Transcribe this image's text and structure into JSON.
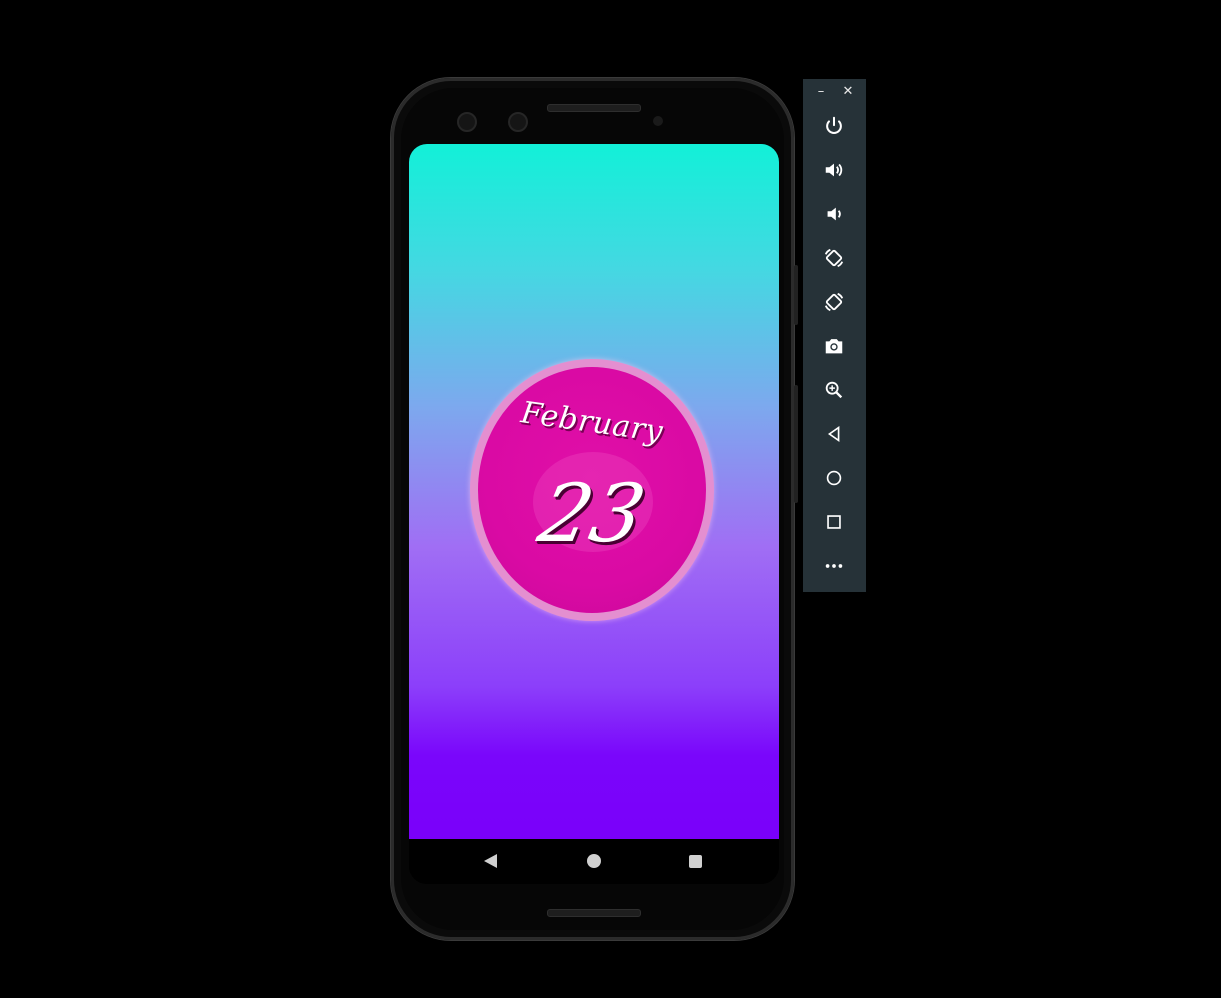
{
  "screen": {
    "month": "February",
    "day": "23"
  },
  "navbar": {
    "back_icon": "back-triangle",
    "home_icon": "home-circle",
    "recents_icon": "recents-square"
  },
  "toolbar": {
    "minimize_label": "–",
    "close_label": "✕",
    "buttons": [
      {
        "name": "power-icon"
      },
      {
        "name": "volume-up-icon"
      },
      {
        "name": "volume-down-icon"
      },
      {
        "name": "rotate-left-icon"
      },
      {
        "name": "rotate-right-icon"
      },
      {
        "name": "camera-icon"
      },
      {
        "name": "zoom-icon"
      },
      {
        "name": "back-icon"
      },
      {
        "name": "home-icon"
      },
      {
        "name": "overview-icon"
      },
      {
        "name": "more-icon"
      }
    ]
  },
  "colors": {
    "gradient_top": "#12f0d8",
    "gradient_bottom": "#7a00fa",
    "badge": "#da0aa4",
    "badge_ring": "#e48fd0",
    "toolbar": "#263238"
  }
}
